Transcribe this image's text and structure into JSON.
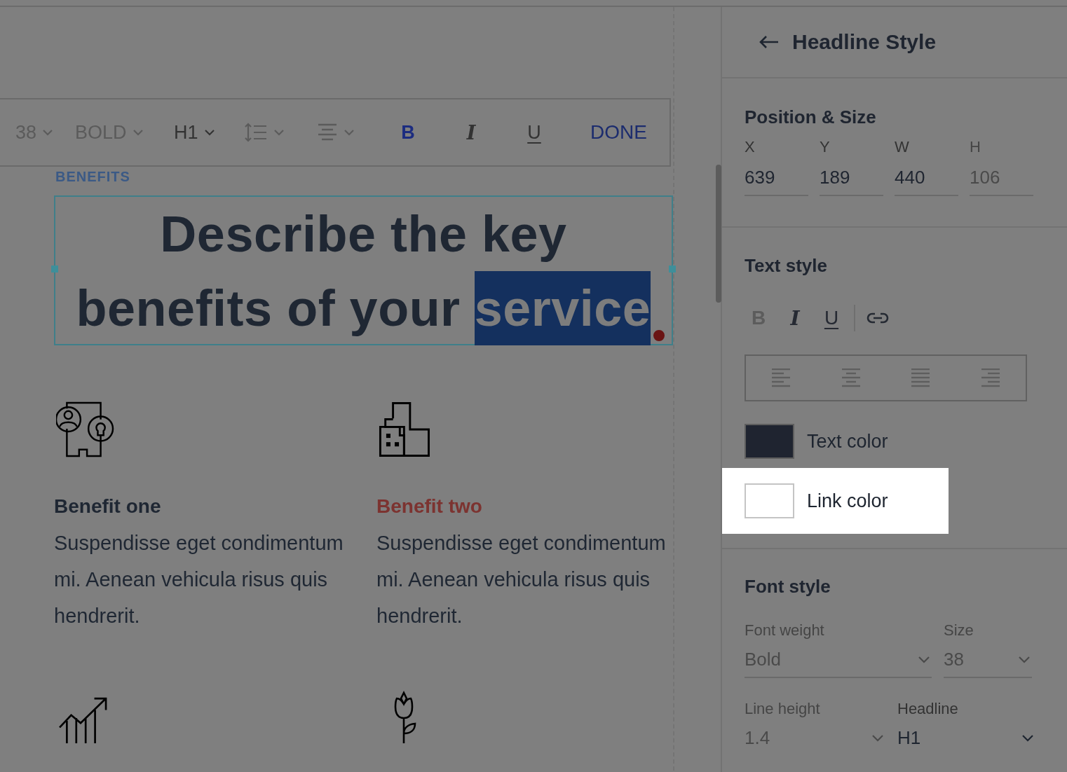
{
  "toolbar": {
    "items": [
      {
        "kind": "dropdown",
        "label": "38",
        "disabled": true
      },
      {
        "kind": "dropdown",
        "label": "BOLD",
        "disabled": true
      },
      {
        "kind": "dropdown",
        "label": "H1",
        "disabled": false
      },
      {
        "kind": "line-spacing"
      },
      {
        "kind": "align"
      },
      {
        "kind": "format",
        "label": "B",
        "on": true
      },
      {
        "kind": "format",
        "label": "I",
        "on": false
      },
      {
        "kind": "format",
        "label": "U",
        "on": false
      },
      {
        "kind": "done",
        "label": "DONE"
      }
    ]
  },
  "canvas": {
    "eyebrow": "BENEFITS",
    "headline": [
      [
        {
          "text": "Describe the key",
          "selected": false
        }
      ],
      [
        {
          "text": "benefits of your",
          "selected": false
        },
        {
          "text": "service",
          "selected": true
        }
      ]
    ],
    "benefits": [
      {
        "title": "Benefit one",
        "highlighted": false,
        "body": "Suspendisse eget condimentum mi. Aenean vehicula risus quis hendrerit."
      },
      {
        "title": "Benefit two",
        "highlighted": true,
        "body": "Suspendisse eget condimentum mi. Aenean vehicula risus quis hendrerit."
      }
    ]
  },
  "panel": {
    "title": "Headline Style",
    "position": {
      "title": "Position & Size",
      "fields": [
        {
          "label": "X",
          "value": "639",
          "disabled": false
        },
        {
          "label": "Y",
          "value": "189",
          "disabled": false
        },
        {
          "label": "W",
          "value": "440",
          "disabled": false
        },
        {
          "label": "H",
          "value": "106",
          "disabled": true
        }
      ]
    },
    "text_style": {
      "title": "Text style",
      "format": [
        {
          "label": "B",
          "disabled": true
        },
        {
          "label": "I",
          "disabled": false
        },
        {
          "label": "U",
          "disabled": false
        }
      ],
      "colors": [
        {
          "label": "Text color",
          "color": "#1f2430",
          "highlighted": false
        },
        {
          "label": "Link color",
          "color": "#ffffff",
          "highlighted": true
        }
      ]
    },
    "font_style": {
      "title": "Font style",
      "fields": [
        {
          "label": "Font weight",
          "value": "Bold",
          "disabled": true
        },
        {
          "label": "Size",
          "value": "38",
          "disabled": true
        },
        {
          "label": "Line height",
          "value": "1.4",
          "disabled": true
        },
        {
          "label": "Headline",
          "value": "H1",
          "disabled": false
        }
      ]
    }
  }
}
